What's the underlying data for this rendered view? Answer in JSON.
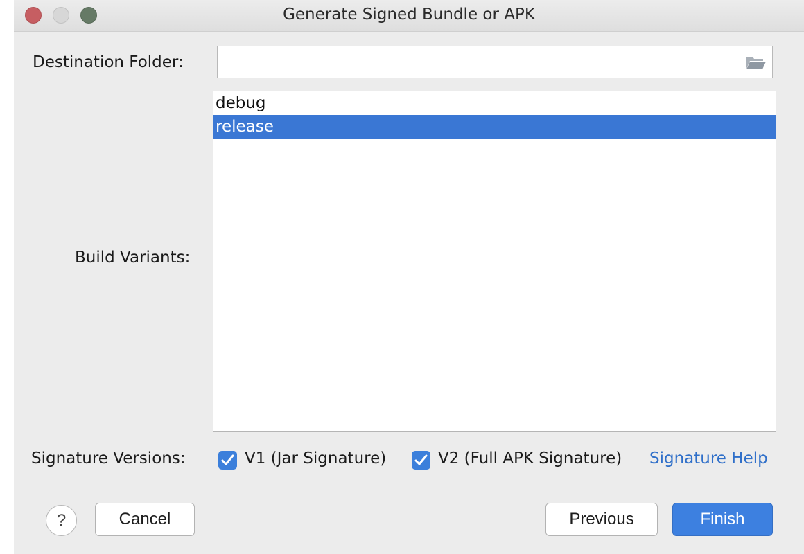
{
  "window": {
    "title": "Generate Signed Bundle or APK"
  },
  "destination": {
    "label": "Destination Folder:",
    "value": "",
    "icon": "folder-open-icon"
  },
  "build_variants": {
    "label": "Build Variants:",
    "items": [
      {
        "label": "debug",
        "selected": false
      },
      {
        "label": "release",
        "selected": true
      }
    ]
  },
  "signature": {
    "label": "Signature Versions:",
    "v1_label": "V1 (Jar Signature)",
    "v1_checked": true,
    "v2_label": "V2 (Full APK Signature)",
    "v2_checked": true,
    "help_link": "Signature Help"
  },
  "buttons": {
    "help": "?",
    "cancel": "Cancel",
    "previous": "Previous",
    "finish": "Finish"
  },
  "colors": {
    "accent": "#3d80e0",
    "selection": "#3a77d4",
    "link": "#2f6fc9"
  }
}
